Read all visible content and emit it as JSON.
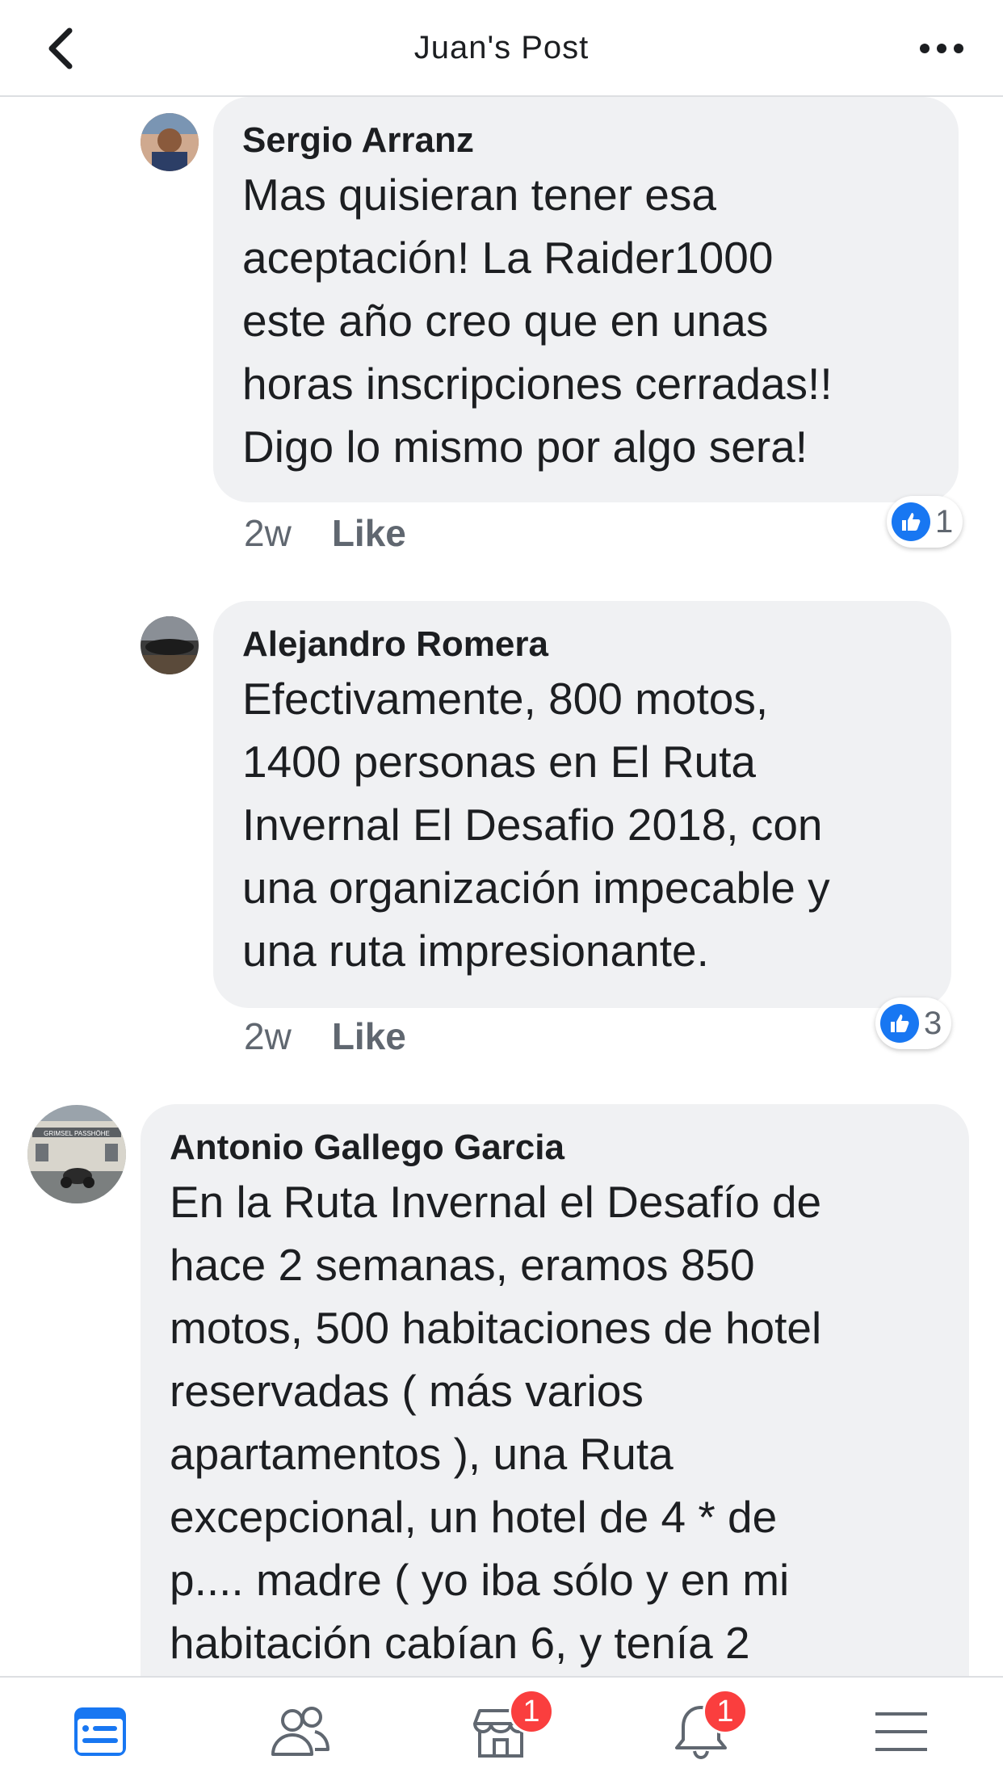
{
  "header": {
    "title": "Juan's Post",
    "back_icon": "chevron-left-icon",
    "more_icon": "more-horizontal-icon"
  },
  "comments": [
    {
      "author": "Sergio Arranz",
      "text": "Mas quisieran tener esa\naceptación! La Raider1000\neste año creo que en unas\nhoras inscripciones cerradas!!\nDigo lo mismo por algo sera!",
      "time": "2w",
      "like_label": "Like",
      "reaction_count": "1"
    },
    {
      "author": "Alejandro Romera",
      "text": "Efectivamente,  800 motos,\n1400 personas en El Ruta\nInvernal El Desafio 2018,  con\nuna organización impecable y\nuna ruta impresionante.",
      "time": "2w",
      "like_label": "Like",
      "reaction_count": "3"
    },
    {
      "author": "Antonio Gallego Garcia",
      "text": "En la Ruta Invernal el Desafío de\nhace 2 semanas, eramos 850\nmotos, 500 habitaciones de hotel\nreservadas ( más varios\napartamentos ), una Ruta\nexcepcional, un hotel de 4 * de\np.... madre (  yo iba sólo y en mi\nhabitación cabían 6, y tenía 2",
      "avatar_sign": "GRIMSEL PASSHÖHE"
    }
  ],
  "tabbar": {
    "items": [
      {
        "icon": "news-feed-icon",
        "active": true
      },
      {
        "icon": "friends-icon",
        "active": false
      },
      {
        "icon": "marketplace-icon",
        "active": false,
        "badge": "1"
      },
      {
        "icon": "notifications-bell-icon",
        "active": false,
        "badge": "1"
      },
      {
        "icon": "menu-icon",
        "active": false
      }
    ]
  },
  "colors": {
    "accent": "#1877f2",
    "bubble": "#f0f1f3",
    "badge": "#fa3e3e",
    "secondary_text": "#606770"
  }
}
